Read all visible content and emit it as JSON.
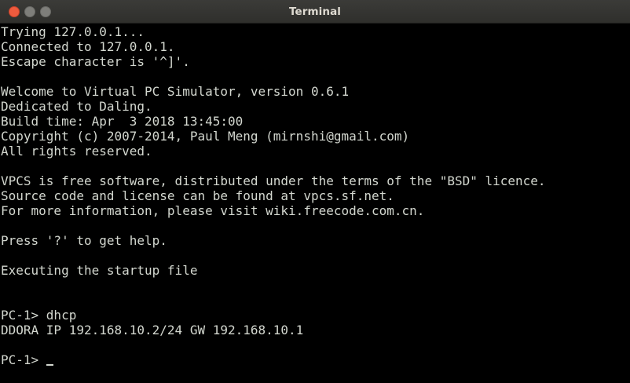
{
  "window": {
    "title": "Terminal"
  },
  "terminal": {
    "lines": [
      "Trying 127.0.0.1...",
      "Connected to 127.0.0.1.",
      "Escape character is '^]'.",
      "",
      "Welcome to Virtual PC Simulator, version 0.6.1",
      "Dedicated to Daling.",
      "Build time: Apr  3 2018 13:45:00",
      "Copyright (c) 2007-2014, Paul Meng (mirnshi@gmail.com)",
      "All rights reserved.",
      "",
      "VPCS is free software, distributed under the terms of the \"BSD\" licence.",
      "Source code and license can be found at vpcs.sf.net.",
      "For more information, please visit wiki.freecode.com.cn.",
      "",
      "Press '?' to get help.",
      "",
      "Executing the startup file",
      "",
      "",
      "PC-1> dhcp",
      "DDORA IP 192.168.10.2/24 GW 192.168.10.1",
      ""
    ],
    "prompt": "PC-1> "
  },
  "colors": {
    "background": "#000000",
    "foreground": "#d3d7cf",
    "titlebar": "#3b3b38",
    "close_button": "#ee5b3e",
    "title_text": "#dfdbd2"
  }
}
